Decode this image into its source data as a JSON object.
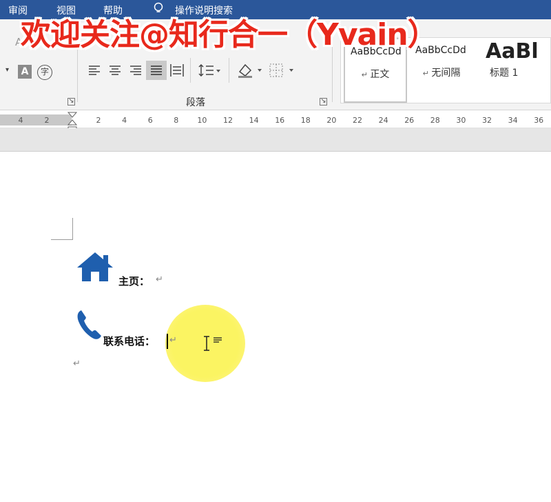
{
  "menubar": {
    "items": [
      "审阅",
      "视图",
      "帮助"
    ],
    "search_label": "操作说明搜索"
  },
  "watermark": "欢迎关注@知行合一（Yvain）",
  "ribbon": {
    "paragraph_group_label": "段落",
    "styles": [
      {
        "sample": "AaBbCcDd",
        "name": "正文"
      },
      {
        "sample": "AaBbCcDd",
        "name": "无间隔"
      },
      {
        "sample": "AaBl",
        "name": "标题 1"
      }
    ]
  },
  "ruler": {
    "left_ticks": [
      "4",
      "2"
    ],
    "right_ticks": [
      "2",
      "4",
      "6",
      "8",
      "10",
      "12",
      "14",
      "16",
      "18",
      "20",
      "22",
      "24",
      "26",
      "28",
      "30",
      "32",
      "34",
      "36"
    ]
  },
  "document": {
    "line1_label": "主页：",
    "line2_label": "联系电话：",
    "paragraph_mark": "↵"
  },
  "colors": {
    "menubar_bg": "#2b579a",
    "icon_blue": "#1f5fae",
    "highlight": "#fbf35a",
    "watermark": "#e8291c"
  }
}
